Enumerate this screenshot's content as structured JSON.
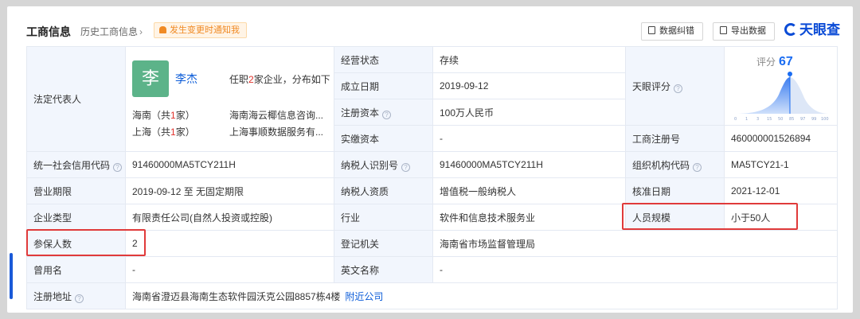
{
  "header": {
    "title": "工商信息",
    "history": "历史工商信息",
    "history_chevron": "›",
    "notify": "发生变更时通知我",
    "btn_correct": "数据纠错",
    "btn_export": "导出数据",
    "logo": "天眼查"
  },
  "rep": {
    "label": "法定代表人",
    "avatar": "李",
    "name": "李杰",
    "ren_prefix": "任职",
    "ren_count": "2",
    "ren_suffix": "家企业，分布如下",
    "region1_prefix": "海南（共",
    "region1_count": "1",
    "region1_suffix": "家）",
    "region1_company": "海南海云椰信息咨询...",
    "region2_prefix": "上海（共",
    "region2_count": "1",
    "region2_suffix": "家）",
    "region2_company": "上海事顺数据服务有..."
  },
  "fields": {
    "status_label": "经营状态",
    "status": "存续",
    "found_label": "成立日期",
    "found": "2019-09-12",
    "capital_label": "注册资本",
    "capital": "100万人民币",
    "paid_label": "实缴资本",
    "paid": "-",
    "tianyan_label": "天眼评分",
    "score_label": "评分",
    "score": "67",
    "reg_no_label": "工商注册号",
    "reg_no": "460000001526894",
    "credit_label": "统一社会信用代码",
    "credit": "91460000MA5TCY211H",
    "tax_label": "纳税人识别号",
    "tax": "91460000MA5TCY211H",
    "org_label": "组织机构代码",
    "org": "MA5TCY21-1",
    "term_label": "营业期限",
    "term": "2019-09-12 至 无固定期限",
    "taxq_label": "纳税人资质",
    "taxq": "增值税一般纳税人",
    "approve_label": "核准日期",
    "approve": "2021-12-01",
    "type_label": "企业类型",
    "type": "有限责任公司(自然人投资或控股)",
    "industry_label": "行业",
    "industry": "软件和信息技术服务业",
    "staff_label": "人员规模",
    "staff": "小于50人",
    "insured_label": "参保人数",
    "insured": "2",
    "authority_label": "登记机关",
    "authority": "海南省市场监督管理局",
    "used_label": "曾用名",
    "used": "-",
    "en_label": "英文名称",
    "en": "-",
    "addr_label": "注册地址",
    "addr": "海南省澄迈县海南生态软件园沃克公园8857栋4楼",
    "nearby": "附近公司"
  },
  "score_ticks": [
    "0",
    "1",
    "3",
    "15",
    "50",
    "85",
    "97",
    "99",
    "100"
  ],
  "colors": {
    "accent": "#1a6cf2",
    "highlight": "#e03a3a",
    "label_bg": "#f2f6fd"
  }
}
